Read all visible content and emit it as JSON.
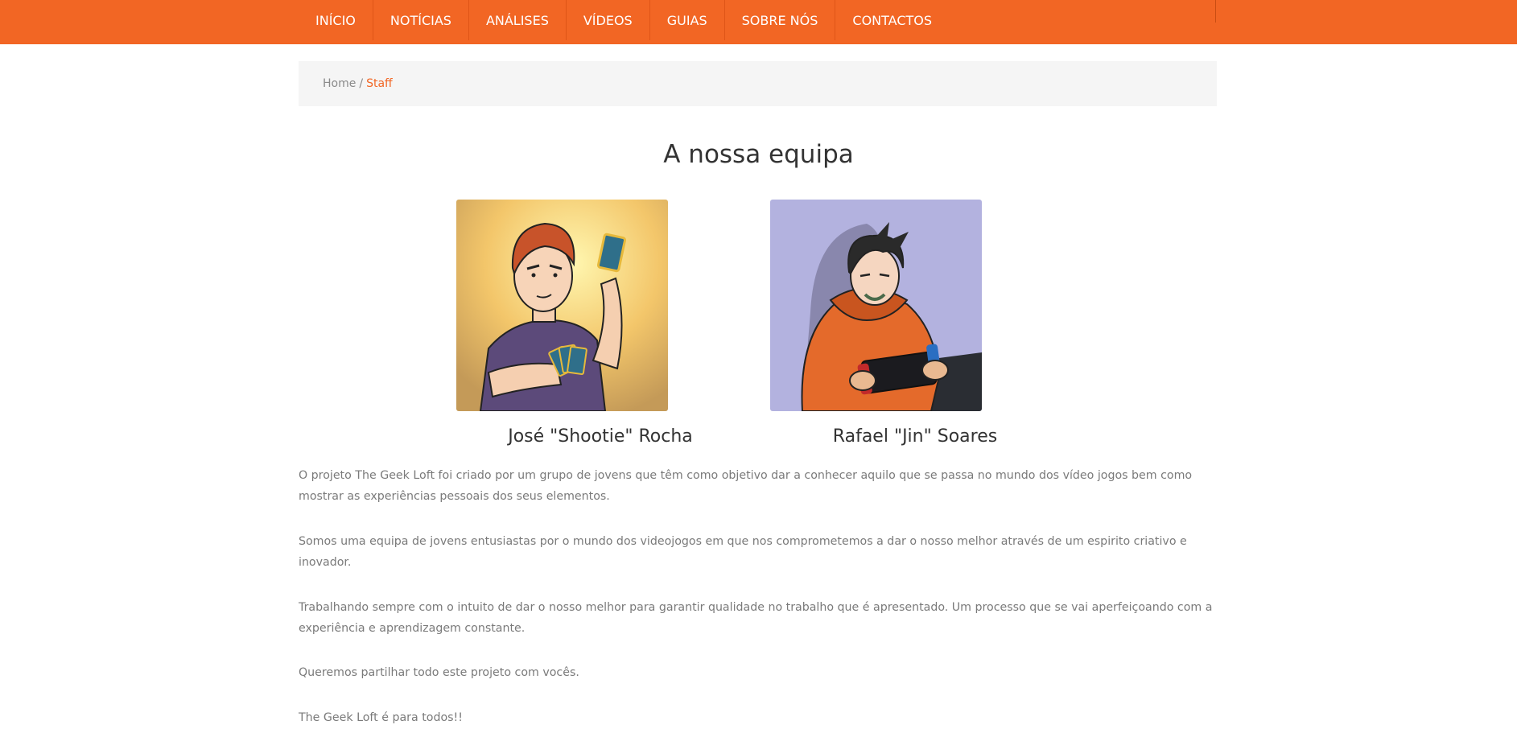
{
  "nav": {
    "items": [
      {
        "label": "INÍCIO"
      },
      {
        "label": "NOTÍCIAS"
      },
      {
        "label": "ANÁLISES"
      },
      {
        "label": "VÍDEOS"
      },
      {
        "label": "GUIAS"
      },
      {
        "label": "SOBRE NÓS"
      },
      {
        "label": "CONTACTOS"
      }
    ]
  },
  "breadcrumb": {
    "home": "Home",
    "separator": "/",
    "current": "Staff"
  },
  "page": {
    "title": "A nossa equipa"
  },
  "team": [
    {
      "name": "José \"Shootie\" Rocha"
    },
    {
      "name": "Rafael \"Jin\" Soares"
    }
  ],
  "about": {
    "paragraphs": [
      "O projeto The Geek Loft foi criado por um grupo de jovens que têm como objetivo dar a conhecer aquilo que se passa no mundo dos vídeo jogos bem como mostrar as experiências pessoais dos seus elementos.",
      "Somos uma equipa de jovens entusiastas por o mundo dos videojogos em que nos comprometemos a dar o nosso melhor através de um espirito criativo e inovador.",
      "Trabalhando sempre com o intuito de dar o nosso melhor para garantir qualidade no trabalho que é apresentado. Um processo que se vai aperfeiçoando com a experiência e aprendizagem constante.",
      "Queremos partilhar todo este projeto com vocês.",
      "The Geek Loft é para todos!!"
    ]
  },
  "colors": {
    "brand": "#f26624",
    "breadcrumb_bg": "#f5f5f5",
    "text": "#333333",
    "muted_text": "#7a7a7a"
  }
}
